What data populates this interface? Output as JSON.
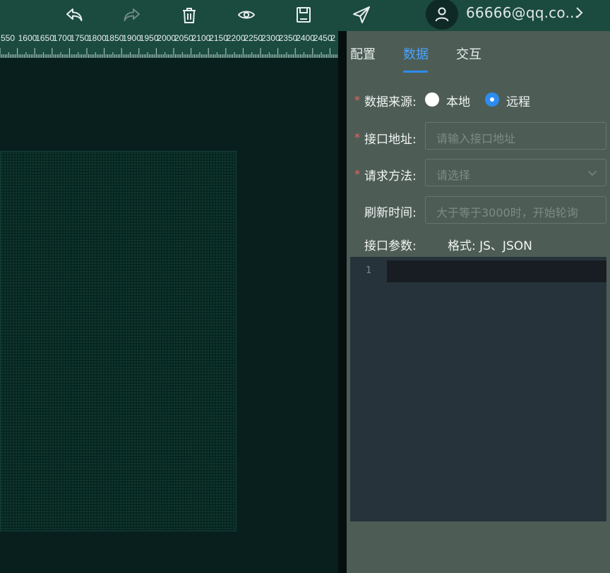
{
  "toolbar": {
    "icons": [
      "undo-icon",
      "redo-icon",
      "trash-icon",
      "eye-icon",
      "save-icon",
      "send-icon"
    ],
    "user_email": "66666@qq.co..."
  },
  "ruler": {
    "ticks": [
      "550",
      "1600",
      "1650",
      "1700",
      "1750",
      "1800",
      "1850",
      "1900",
      "1950",
      "2000",
      "2050",
      "2100",
      "2150",
      "2200",
      "2250",
      "2300",
      "2350",
      "2400",
      "2450",
      "2"
    ]
  },
  "panel": {
    "tabs": [
      {
        "label": "配置",
        "active": false
      },
      {
        "label": "数据",
        "active": true
      },
      {
        "label": "交互",
        "active": false
      }
    ],
    "data_source": {
      "label": "数据来源:",
      "options": [
        {
          "label": "本地",
          "checked": false
        },
        {
          "label": "远程",
          "checked": true
        }
      ]
    },
    "api_url": {
      "label": "接口地址:",
      "placeholder": "请输入接口地址"
    },
    "method": {
      "label": "请求方法:",
      "placeholder": "请选择"
    },
    "refresh": {
      "label": "刷新时间:",
      "placeholder": "大于等于3000时，开始轮询"
    },
    "params": {
      "label": "接口参数:",
      "hint": "格式: JS、JSON"
    },
    "editor": {
      "line_numbers": [
        "1"
      ]
    }
  },
  "colors": {
    "accent": "#2d8cf0",
    "toolbar_bg": "#1b4a3e",
    "panel_bg": "#4d5d56",
    "canvas_bg": "#081f1e",
    "required": "#ff5a5a"
  }
}
